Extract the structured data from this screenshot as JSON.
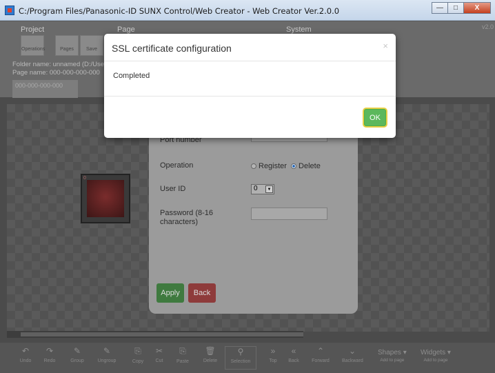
{
  "window": {
    "title": "C:/Program Files/Panasonic-ID SUNX Control/Web Creator - Web Creator Ver.2.0.0",
    "version_label": "v2.0"
  },
  "ribbon": {
    "groups": [
      "Project",
      "Page",
      "System"
    ],
    "buttons": [
      "Operations",
      "Pages",
      "Save"
    ],
    "folder_name": "Folder name: unnamed (D:/User",
    "page_name": "Page name: 000-000-000-000",
    "page_tab": "000-000-000-000"
  },
  "panel": {
    "port_label": "Port number",
    "operation_label": "Operation",
    "register_label": "Register",
    "delete_label": "Delete",
    "operation_selected": "Delete",
    "user_id_label": "User ID",
    "user_id_value": "0",
    "password_label_line1": "Password (8-16",
    "password_label_line2": "characters)",
    "apply_label": "Apply",
    "back_label": "Back"
  },
  "widget": {
    "badge": "0"
  },
  "toolbar": {
    "items": [
      "Undo",
      "Redo",
      "Group",
      "Ungroup",
      "Copy",
      "Cut",
      "Paste",
      "Delete",
      "Selection",
      "Top",
      "Back",
      "Forward",
      "Backward"
    ],
    "shapes_label": "Shapes",
    "shapes_sub": "Add to page",
    "widgets_label": "Widgets",
    "widgets_sub": "Add to page"
  },
  "modal": {
    "title": "SSL certificate configuration",
    "close": "×",
    "message": "Completed",
    "ok_label": "OK"
  },
  "colors": {
    "ok_button": "#5cb85c",
    "apply_button": "#3f7a3f",
    "back_button": "#8e3b3b",
    "focus_ring": "#e8cf44"
  }
}
